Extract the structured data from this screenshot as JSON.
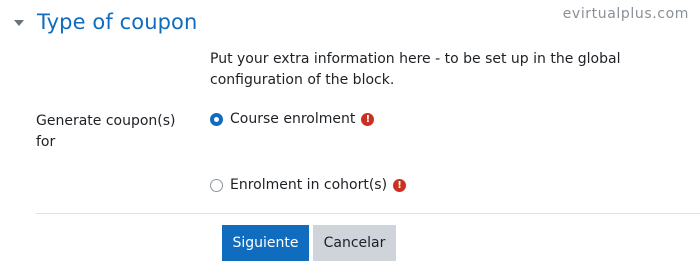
{
  "section": {
    "title": "Type of coupon",
    "toggle_icon": "caret-down-icon"
  },
  "watermark": "evirtualplus.com",
  "info_text": "Put your extra information here - to be set up in the global configuration of the block.",
  "field": {
    "label": "Generate coupon(s) for",
    "options": [
      {
        "label": "Course enrolment",
        "selected": true,
        "required_icon": "exclamation-circle-icon"
      },
      {
        "label": "Enrolment in cohort(s)",
        "selected": false,
        "required_icon": "exclamation-circle-icon"
      }
    ],
    "required_glyph": "!"
  },
  "buttons": {
    "next": "Siguiente",
    "cancel": "Cancelar"
  },
  "colors": {
    "accent": "#0f6cbf",
    "required": "#ca3120",
    "secondary_button": "#ced4da"
  }
}
